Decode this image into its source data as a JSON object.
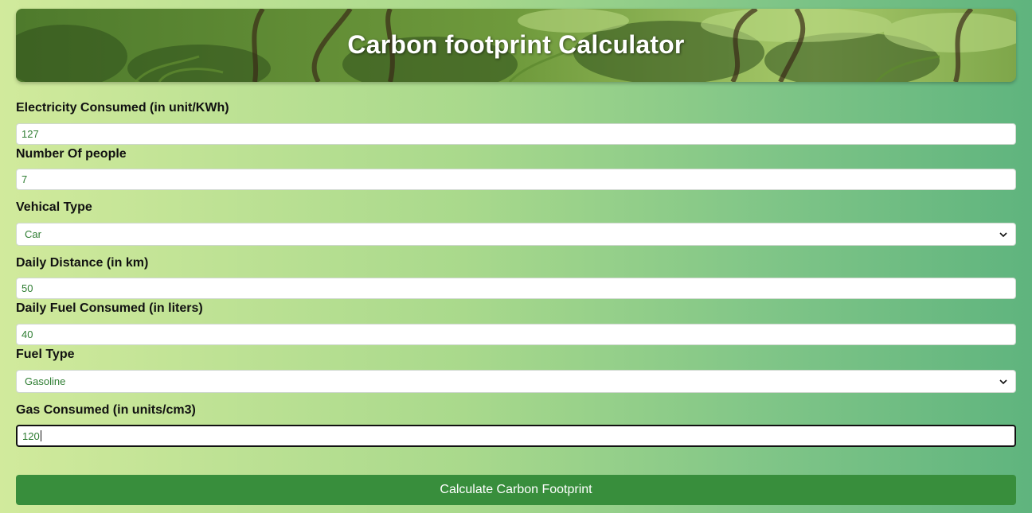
{
  "header": {
    "title": "Carbon footprint Calculator"
  },
  "form": {
    "electricity": {
      "label": "Electricity Consumed (in unit/KWh)",
      "value": "127"
    },
    "people": {
      "label": "Number Of people",
      "value": "7"
    },
    "vehicle_type": {
      "label": "Vehical Type",
      "selected": "Car"
    },
    "daily_distance": {
      "label": "Daily Distance (in km)",
      "value": "50"
    },
    "daily_fuel": {
      "label": "Daily Fuel Consumed (in liters)",
      "value": "40"
    },
    "fuel_type": {
      "label": "Fuel Type",
      "selected": "Gasoline"
    },
    "gas_consumed": {
      "label": "Gas Consumed (in units/cm3)",
      "value": "120"
    }
  },
  "actions": {
    "calculate_label": "Calculate Carbon Footprint"
  },
  "colors": {
    "button": "#388e3c",
    "input_text": "#2e7d32",
    "label_text": "#111111"
  },
  "icons": {
    "select_arrow": "chevron-down-icon",
    "banner_image": "forest-image"
  }
}
